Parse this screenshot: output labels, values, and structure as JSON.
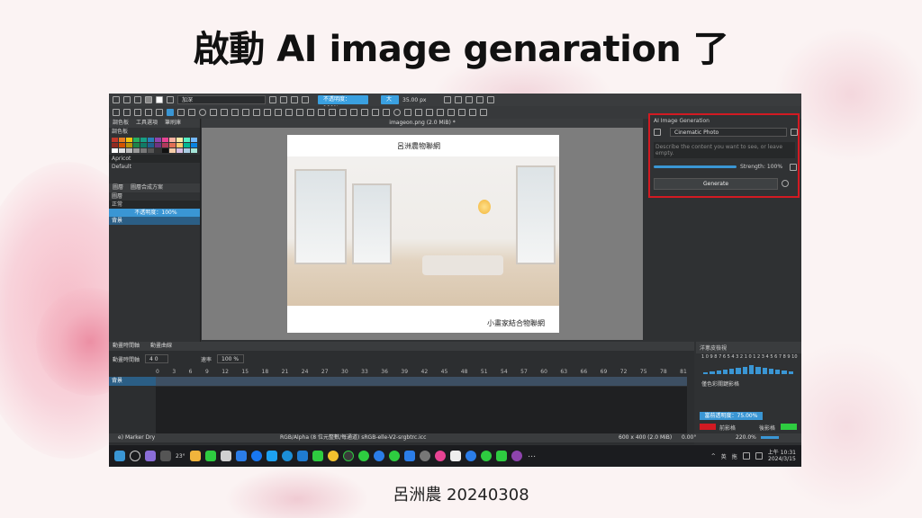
{
  "slide": {
    "title": "啟動 AI image genaration  了",
    "footer": "呂洲農 20240308"
  },
  "krita": {
    "toolbar": {
      "blend_mode": "加深",
      "opacity_label": "不透明度：100%",
      "size_label": "大",
      "size_value": "35.00 px"
    },
    "left_panel": {
      "tabs": [
        "調色板",
        "工具選項",
        "筆刷庫"
      ],
      "palette_title": "調色板",
      "color_name": "Apricot",
      "preset": "Default",
      "sub_tabs": [
        "圖層",
        "圖層合成方案"
      ],
      "layers_title": "圖層",
      "blend": "正常",
      "opacity": "不透明度：100%",
      "layer_name": "背景"
    },
    "canvas": {
      "tab_title": "imageon.png (2.0 MiB) *",
      "image_title": "呂洲農物聯網",
      "image_caption": "小畫家結合物聯網"
    },
    "ai_panel": {
      "title": "AI Image Generation",
      "style": "Cinematic Photo",
      "prompt_placeholder": "Describe the content you want to see, or leave empty.",
      "strength": "Strength: 100%",
      "generate": "Generate",
      "accent_color": "#d21a22"
    },
    "bottom": {
      "tabs": [
        "動畫時間軸",
        "動畫曲線"
      ],
      "label": "動畫時間軸",
      "frame": "4 0",
      "speed_label": "速率",
      "speed_value": "100 %",
      "ruler": [
        "0",
        "3",
        "6",
        "9",
        "12",
        "15",
        "18",
        "21",
        "24",
        "27",
        "30",
        "33",
        "36",
        "39",
        "42",
        "45",
        "48",
        "51",
        "54",
        "57",
        "60",
        "63",
        "66",
        "69",
        "72",
        "75",
        "78",
        "81"
      ],
      "track_label": "背景"
    },
    "right_bottom": {
      "title": "洋蔥皮檢視",
      "numbers": "1 0 9 8 7 6 5 4 3 2 1 0 1 2 3 4 5 6 7 8 9 10",
      "checkbox_label": "僅色彩關鍵影格",
      "opacity": "當前透明度：75.00%",
      "prev_label": "前影格",
      "next_label": "後影格"
    },
    "status": {
      "brush": "e) Marker Dry",
      "color_info": "RGB/Alpha (8 位元整數/每通道)  sRGB-elle-V2-srgbtrc.icc",
      "size": "600 x 400 (2.0 MiB)",
      "rotation": "0.00°",
      "zoom": "220.0%"
    },
    "taskbar": {
      "weather": "23°",
      "ime1": "英",
      "ime2": "拖",
      "time": "上午 10:31",
      "date": "2024/3/15"
    }
  }
}
